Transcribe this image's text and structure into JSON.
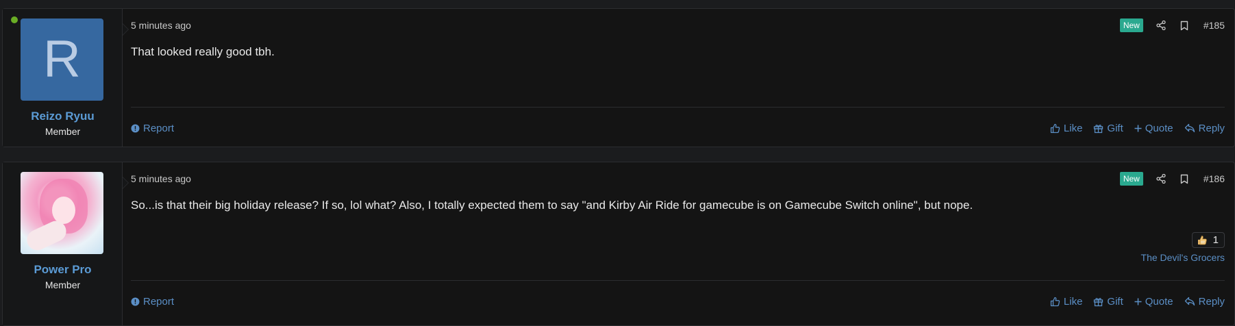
{
  "posts": [
    {
      "author": "Reizo Ryuu",
      "avatar_letter": "R",
      "user_title": "Member",
      "online": true,
      "time": "5 minutes ago",
      "badge": "New",
      "post_number": "#185",
      "message": "That looked really good tbh.",
      "report_label": "Report",
      "actions": {
        "like": "Like",
        "gift": "Gift",
        "quote": "Quote",
        "reply": "Reply"
      }
    },
    {
      "author": "Power Pro",
      "user_title": "Member",
      "time": "5 minutes ago",
      "badge": "New",
      "post_number": "#186",
      "message": "So...is that their big holiday release? If so, lol what? Also, I totally expected them to say \"and Kirby Air Ride for gamecube is on Gamecube Switch online\", but nope.",
      "reaction": {
        "icon": "thumbs-up-icon",
        "count": "1",
        "users": "The Devil's Grocers"
      },
      "report_label": "Report",
      "actions": {
        "like": "Like",
        "gift": "Gift",
        "quote": "Quote",
        "reply": "Reply"
      }
    }
  ],
  "colors": {
    "background": "#1b1c1e",
    "post_bg": "#141414",
    "link": "#5b8fc6",
    "username": "#5b9bd5",
    "badge_new": "#2aa98f",
    "avatar_r": "#3668a0",
    "online": "#6aad25"
  }
}
